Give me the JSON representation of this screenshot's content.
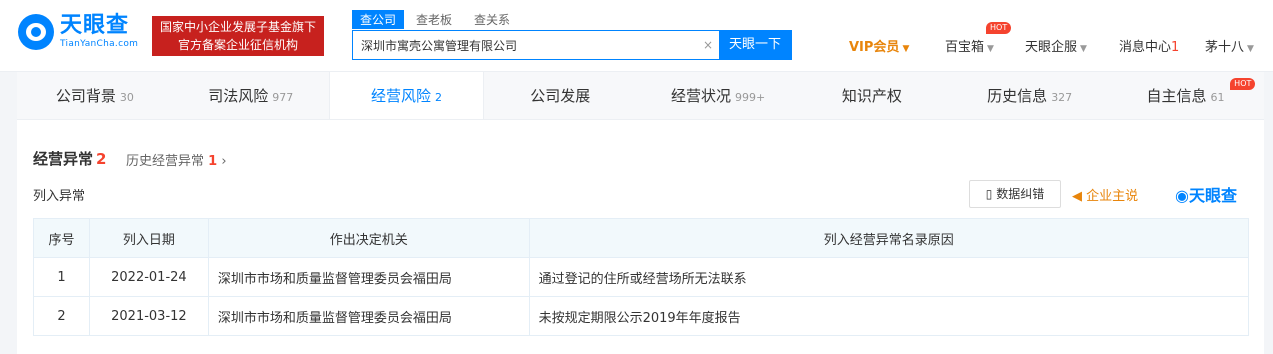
{
  "header": {
    "logo_cn": "天眼查",
    "logo_en": "TianYanCha.com",
    "badge_line1": "国家中小企业发展子基金旗下",
    "badge_line2": "官方备案企业征信机构",
    "search_tabs": [
      "查公司",
      "查老板",
      "查关系"
    ],
    "search_value": "深圳市寓壳公寓管理有限公司",
    "search_clear": "×",
    "search_button": "天眼一下",
    "nav": {
      "vip": "VIP会员",
      "toolbox": "百宝箱",
      "enterprise": "天眼企服",
      "messages": "消息中心",
      "messages_count": "1",
      "user": "茅十八",
      "hot": "HOT"
    }
  },
  "tabs": [
    {
      "label": "公司背景",
      "count": "30"
    },
    {
      "label": "司法风险",
      "count": "977"
    },
    {
      "label": "经营风险",
      "count": "2"
    },
    {
      "label": "公司发展",
      "count": ""
    },
    {
      "label": "经营状况",
      "count": "999+"
    },
    {
      "label": "知识产权",
      "count": ""
    },
    {
      "label": "历史信息",
      "count": "327"
    },
    {
      "label": "自主信息",
      "count": "61"
    }
  ],
  "section": {
    "title": "经营异常",
    "count": "2",
    "history_label": "历史经营异常",
    "history_count": "1",
    "subtitle": "列入异常",
    "correct_button": "数据纠错",
    "owner_say": "企业主说",
    "brand": "天眼查"
  },
  "table": {
    "headers": [
      "序号",
      "列入日期",
      "作出决定机关",
      "列入经营异常名录原因"
    ],
    "rows": [
      [
        "1",
        "2022-01-24",
        "深圳市市场和质量监督管理委员会福田局",
        "通过登记的住所或经营场所无法联系"
      ],
      [
        "2",
        "2021-03-12",
        "深圳市市场和质量监督管理委员会福田局",
        "未按规定期限公示2019年年度报告"
      ]
    ]
  },
  "colors": {
    "brand_blue": "#0084ff",
    "badge_red": "#c7211e",
    "accent_red": "#f5432e",
    "vip_orange": "#e8850b"
  }
}
